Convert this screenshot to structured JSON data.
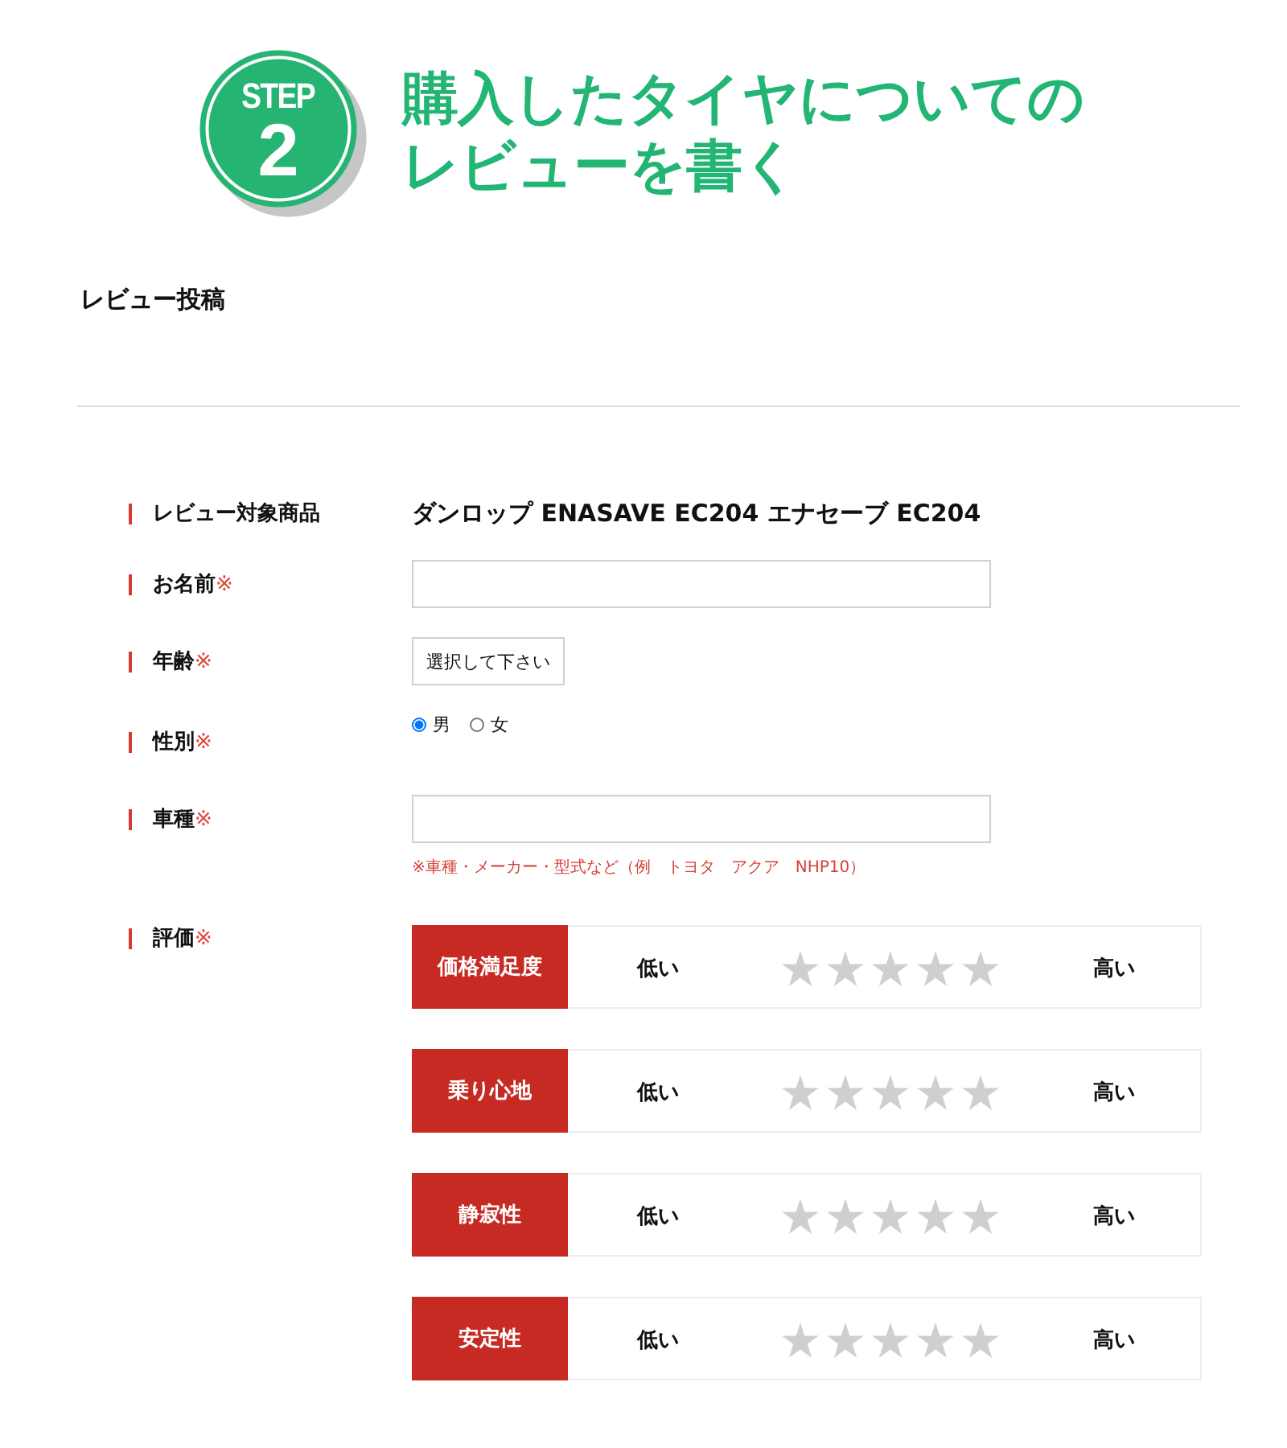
{
  "header": {
    "badge": {
      "label": "STEP",
      "number": "2"
    },
    "title_lines": [
      "購入したタイヤについての",
      "レビューを書く"
    ]
  },
  "section_title": "レビュー投稿",
  "form": {
    "rows": [
      {
        "kind": "text",
        "label": "レビュー対象商品",
        "value": "ダンロップ ENASAVE EC204 エナセーブ EC204"
      },
      {
        "kind": "input",
        "label": "お名前",
        "mark": "※"
      },
      {
        "kind": "select",
        "label": "年齢",
        "mark": "※",
        "value": "選択して下さい"
      },
      {
        "kind": "radio",
        "label": "性別",
        "mark": "※",
        "options": [
          {
            "label": "男",
            "selected": true
          },
          {
            "label": "女",
            "selected": false
          }
        ]
      },
      {
        "kind": "input",
        "label": "車種",
        "mark": "※",
        "hint": "※車種・メーカー・型式など（例　トヨタ　アクア　NHP10）"
      },
      {
        "kind": "rating",
        "label": "評価",
        "mark": "※",
        "criteria": [
          {
            "name": "価格満足度",
            "low": "低い",
            "high": "高い",
            "stars": 0
          },
          {
            "name": "乗り心地",
            "low": "低い",
            "high": "高い",
            "stars": 0
          },
          {
            "name": "静寂性",
            "low": "低い",
            "high": "高い",
            "stars": 0
          },
          {
            "name": "安定性",
            "low": "低い",
            "high": "高い",
            "stars": 0
          }
        ]
      }
    ]
  }
}
